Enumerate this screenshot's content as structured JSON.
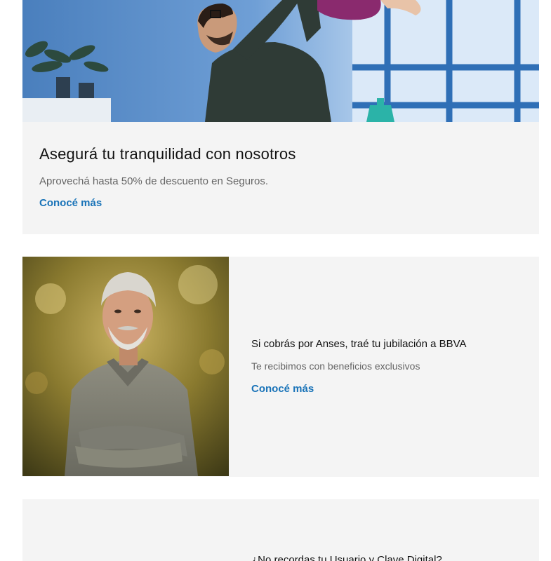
{
  "cards": [
    {
      "image_alt": "Padre levantando a su hija en el aire",
      "title": "Asegurá tu tranquilidad con nosotros",
      "description": "Aprovechá hasta 50% de descuento en Seguros.",
      "link_label": "Conocé más"
    },
    {
      "image_alt": "Hombre mayor con brazos cruzados",
      "title": "Si cobrás por Anses, traé tu jubilación a BBVA",
      "description": "Te recibimos con beneficios exclusivos",
      "link_label": "Conocé más"
    },
    {
      "title": "¿No recordas tu Usuario y Clave Digital?"
    }
  ],
  "colors": {
    "link": "#1973b8",
    "card_bg": "#f4f4f4",
    "title": "#121212",
    "text": "#666666"
  }
}
